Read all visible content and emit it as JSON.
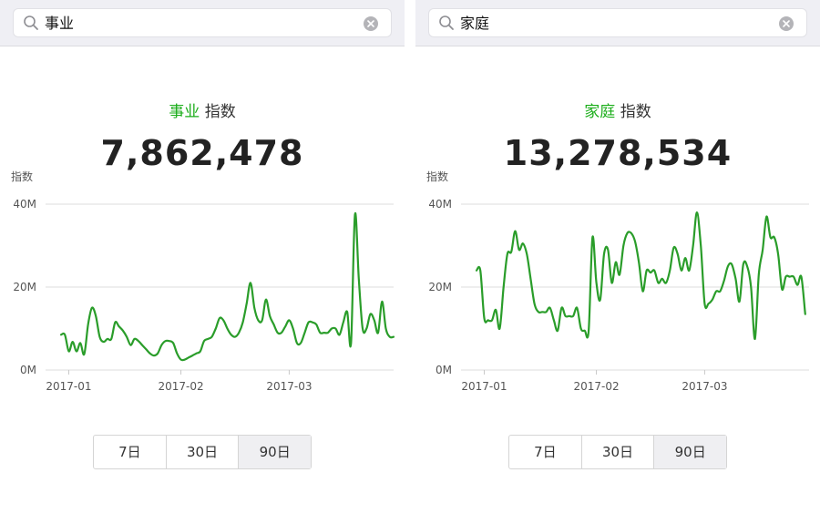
{
  "colors": {
    "accent": "#1aad19",
    "line": "#2a9d2a",
    "grid": "#dcdcdc",
    "axis_text": "#555555"
  },
  "panels": [
    {
      "search": {
        "query": "事业",
        "search_icon": "search-icon",
        "clear_icon": "clear-icon"
      },
      "keyword": "事业",
      "index_label": "指数",
      "index_value": "7,862,478",
      "tabs": [
        {
          "label": "7日"
        },
        {
          "label": "30日"
        },
        {
          "label": "90日",
          "active": true
        }
      ],
      "chart_data": {
        "type": "line",
        "ylabel": "指数",
        "y_ticks": [
          "0M",
          "20M",
          "40M"
        ],
        "ylim": [
          0,
          40
        ],
        "y_unit": "M",
        "x_ticks": [
          "2017-01",
          "2017-02",
          "2017-03"
        ],
        "x_tick_positions": [
          2,
          31,
          59
        ],
        "xlim": [
          -4,
          86
        ],
        "series": [
          {
            "values": [
              8.5,
              8.5,
              4.5,
              6.8,
              4.5,
              6.5,
              3.8,
              11,
              15,
              13,
              8,
              6.8,
              7.5,
              7.5,
              11.5,
              10.5,
              9.5,
              8,
              6,
              7.5,
              7,
              6,
              5,
              4,
              3.5,
              4,
              6,
              7,
              7,
              6.5,
              4,
              2.5,
              2.5,
              3,
              3.5,
              4,
              4.5,
              7,
              7.5,
              8,
              10,
              12.5,
              12,
              10,
              8.5,
              8,
              9,
              11.5,
              16,
              21,
              15,
              12,
              12,
              17,
              13,
              11,
              9,
              9,
              10.5,
              12,
              10,
              6.5,
              6.5,
              9,
              11.5,
              11.5,
              11,
              9,
              9,
              9,
              10,
              10,
              8.5,
              11.5,
              14,
              6.5,
              37.5,
              22,
              10,
              10,
              13.5,
              12,
              9,
              16.5,
              10,
              8,
              8
            ]
          }
        ]
      }
    },
    {
      "search": {
        "query": "家庭",
        "search_icon": "search-icon",
        "clear_icon": "clear-icon"
      },
      "keyword": "家庭",
      "index_label": "指数",
      "index_value": "13,278,534",
      "tabs": [
        {
          "label": "7日"
        },
        {
          "label": "30日"
        },
        {
          "label": "90日",
          "active": true
        }
      ],
      "chart_data": {
        "type": "line",
        "ylabel": "指数",
        "y_ticks": [
          "0M",
          "20M",
          "40M"
        ],
        "ylim": [
          0,
          40
        ],
        "y_unit": "M",
        "x_ticks": [
          "2017-01",
          "2017-02",
          "2017-03"
        ],
        "x_tick_positions": [
          2,
          31,
          59
        ],
        "xlim": [
          -4,
          86
        ],
        "series": [
          {
            "values": [
              24,
              24,
              12.5,
              12,
              12,
              14.5,
              10,
              20,
              28,
              28.5,
              33.5,
              29,
              30.5,
              28,
              22,
              16,
              14,
              14,
              14,
              15,
              12,
              9.5,
              15,
              13,
              13,
              13,
              15,
              10,
              9.5,
              9.5,
              32,
              21,
              17,
              28,
              29,
              21,
              26,
              23,
              30,
              33,
              33,
              31,
              26,
              19,
              24,
              23.5,
              24,
              21,
              22,
              21,
              24,
              29.5,
              28,
              24,
              27,
              24,
              30,
              38,
              30,
              16,
              16,
              17,
              19,
              19,
              21.5,
              25,
              25.5,
              22,
              16.5,
              25.5,
              25,
              20,
              7.5,
              23,
              29,
              37,
              32,
              32,
              28,
              19.5,
              22.5,
              22.5,
              22.5,
              20.5,
              22.5,
              13.5
            ]
          }
        ]
      }
    }
  ]
}
